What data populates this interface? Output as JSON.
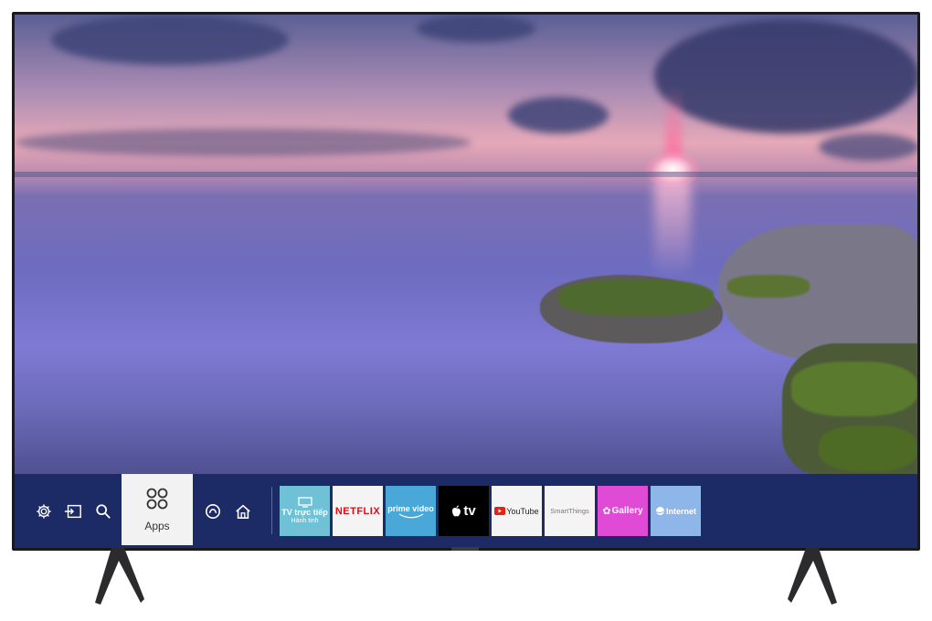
{
  "taskbar": {
    "left_icons": [
      {
        "icon": "gear-icon",
        "label": "Settings"
      },
      {
        "icon": "source-icon",
        "label": "Source"
      },
      {
        "icon": "search-icon",
        "label": "Search"
      }
    ],
    "apps_tile": {
      "label": "Apps",
      "icon": "apps-icon"
    },
    "middle_icons": [
      {
        "icon": "ambient-icon"
      },
      {
        "icon": "home-icon"
      }
    ],
    "app_tiles": [
      {
        "name": "tv-truc-tiep",
        "line1": "TV trực tiếp",
        "line2": "Hành tinh",
        "bg": "#6fc1d6",
        "fg": "#ffffff"
      },
      {
        "name": "netflix",
        "line1": "NETFLIX",
        "bg": "#f4f4f4",
        "fg": "#e50914"
      },
      {
        "name": "prime-video",
        "line1": "prime video",
        "bg": "#4aa8d8",
        "fg": "#ffffff"
      },
      {
        "name": "apple-tv",
        "line1": "tv",
        "bg": "#000000",
        "fg": "#ffffff"
      },
      {
        "name": "youtube",
        "line1": "YouTube",
        "bg": "#f4f4f4",
        "fg": "#222222"
      },
      {
        "name": "smartthings",
        "line1": "SmartThings",
        "bg": "#f4f4f4",
        "fg": "#777777"
      },
      {
        "name": "gallery",
        "line1": "Gallery",
        "bg": "#e04bd6",
        "fg": "#ffffff"
      },
      {
        "name": "internet",
        "line1": "Internet",
        "bg": "#8fb6e8",
        "fg": "#ffffff"
      }
    ]
  },
  "colors": {
    "taskbar_bg": "#1c2a66",
    "accent": "#6fc1d6"
  }
}
